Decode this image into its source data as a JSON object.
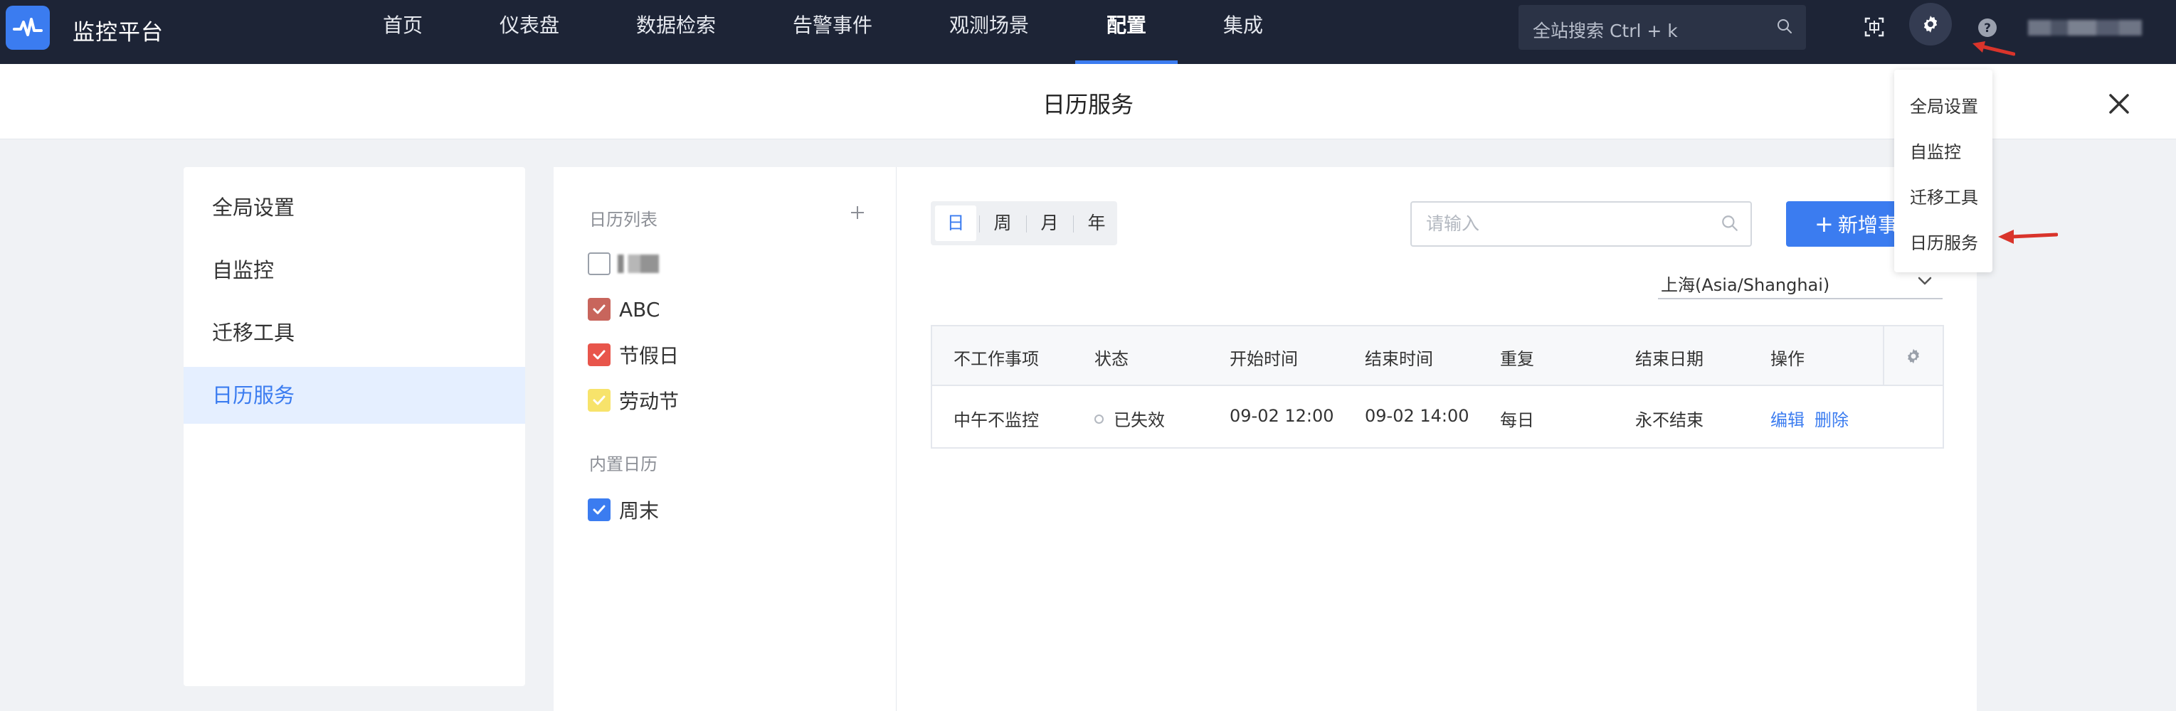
{
  "app": {
    "name": "监控平台"
  },
  "nav": {
    "items": [
      {
        "label": "首页"
      },
      {
        "label": "仪表盘"
      },
      {
        "label": "数据检索"
      },
      {
        "label": "告警事件"
      },
      {
        "label": "观测场景"
      },
      {
        "label": "配置",
        "active": true
      },
      {
        "label": "集成"
      }
    ]
  },
  "search": {
    "placeholder": "全站搜索 Ctrl + k"
  },
  "header": {
    "title": "日历服务"
  },
  "settings_menu": {
    "items": [
      {
        "label": "全局设置"
      },
      {
        "label": "自监控"
      },
      {
        "label": "迁移工具"
      },
      {
        "label": "日历服务"
      }
    ]
  },
  "calendar_list": {
    "title": "日历列表",
    "add_icon": "plus-icon",
    "items": [
      {
        "label": "",
        "checked": false,
        "color": "#ffffff"
      },
      {
        "label": "ABC",
        "checked": true,
        "color": "#c8655c"
      },
      {
        "label": "节假日",
        "checked": true,
        "color": "#e8554b"
      },
      {
        "label": "劳动节",
        "checked": true,
        "color": "#f7e36b"
      }
    ],
    "builtin_title": "内置日历",
    "builtin_items": [
      {
        "label": "周末",
        "checked": true,
        "color": "#3b7cf0"
      }
    ]
  },
  "toolbar": {
    "views": [
      "日",
      "周",
      "月",
      "年"
    ],
    "active_view": "日",
    "search_placeholder": "请输入",
    "new_button": "新增事",
    "timezone": "上海(Asia/Shanghai)"
  },
  "table": {
    "headers": [
      "不工作事项",
      "状态",
      "开始时间",
      "结束时间",
      "重复",
      "结束日期",
      "操作"
    ],
    "rows": [
      {
        "item": "中午不监控",
        "status": "已失效",
        "start": "09-02 12:00",
        "end": "09-02 14:00",
        "repeat": "每日",
        "end_date": "永不结束",
        "actions": [
          "编辑",
          "删除"
        ]
      }
    ]
  },
  "colors": {
    "topbar": "#1d2436",
    "accent": "#3b7cf0",
    "annotation_arrow": "#d9342b"
  }
}
